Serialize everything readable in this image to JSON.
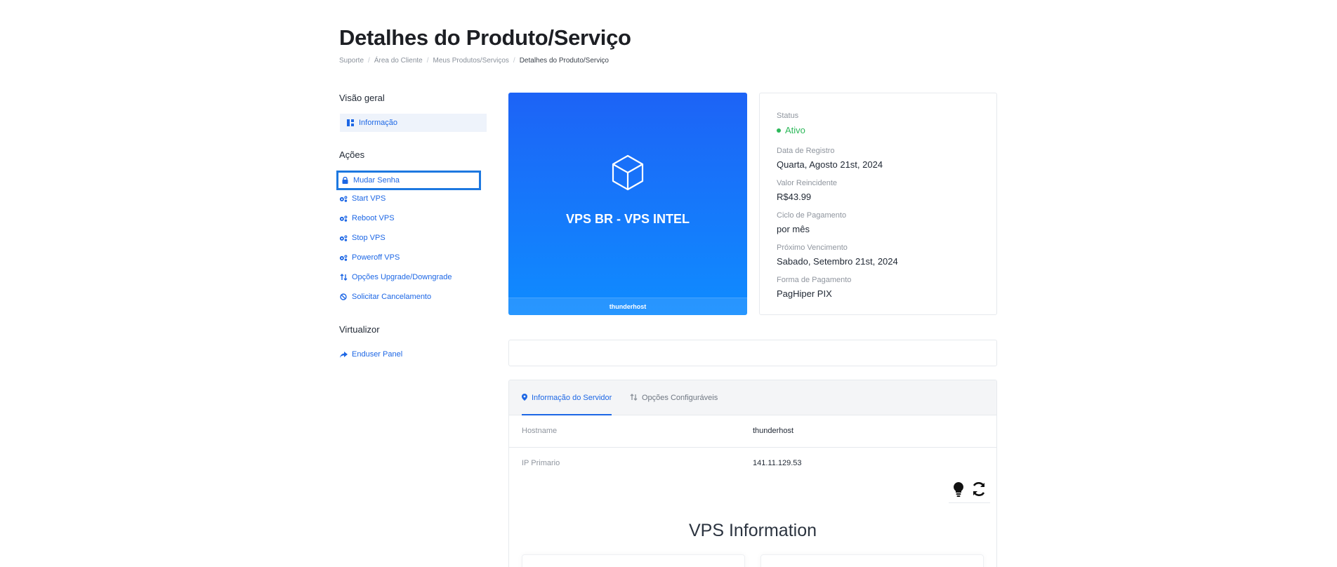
{
  "page": {
    "title": "Detalhes do Produto/Serviço",
    "breadcrumb": [
      "Suporte",
      "Área do Cliente",
      "Meus Produtos/Serviços",
      "Detalhes do Produto/Serviço"
    ]
  },
  "sidebar": {
    "overview_heading": "Visão geral",
    "overview_items": [
      {
        "label": "Informação",
        "icon": "dashboard-icon"
      }
    ],
    "actions_heading": "Ações",
    "action_items": [
      {
        "label": "Mudar Senha",
        "icon": "lock-icon"
      },
      {
        "label": "Start VPS",
        "icon": "gears-icon"
      },
      {
        "label": "Reboot VPS",
        "icon": "gears-icon"
      },
      {
        "label": "Stop VPS",
        "icon": "gears-icon"
      },
      {
        "label": "Poweroff VPS",
        "icon": "gears-icon"
      },
      {
        "label": "Opções Upgrade/Downgrade",
        "icon": "swap-arrows-icon"
      },
      {
        "label": "Solicitar Cancelamento",
        "icon": "ban-icon"
      }
    ],
    "virtualizor_heading": "Virtualizor",
    "virtualizor_items": [
      {
        "label": "Enduser Panel",
        "icon": "share-arrow-icon"
      }
    ]
  },
  "product": {
    "name": "VPS BR - VPS INTEL",
    "footer": "thunderhost",
    "icon": "cube-icon",
    "accent": "#1d63f6"
  },
  "details": {
    "status_label": "Status",
    "status_value": "Ativo",
    "status_color": "#2db85a",
    "registration_label": "Data de Registro",
    "registration_value": "Quarta, Agosto 21st, 2024",
    "recurring_label": "Valor Reincidente",
    "recurring_value": "R$43.99",
    "cycle_label": "Ciclo de Pagamento",
    "cycle_value": "por mês",
    "due_label": "Próximo Vencimento",
    "due_value": "Sabado, Setembro 21st, 2024",
    "payment_label": "Forma de Pagamento",
    "payment_value": "PagHiper PIX"
  },
  "tabs": [
    {
      "label": "Informação do Servidor",
      "icon": "map-pin-icon",
      "active": true
    },
    {
      "label": "Opções Configuráveis",
      "icon": "swap-arrows-icon",
      "active": false
    }
  ],
  "server": {
    "hostname_label": "Hostname",
    "hostname_value": "thunderhost",
    "ip_label": "IP Primario",
    "ip_value": "141.11.129.53"
  },
  "vps_info_title": "VPS Information"
}
